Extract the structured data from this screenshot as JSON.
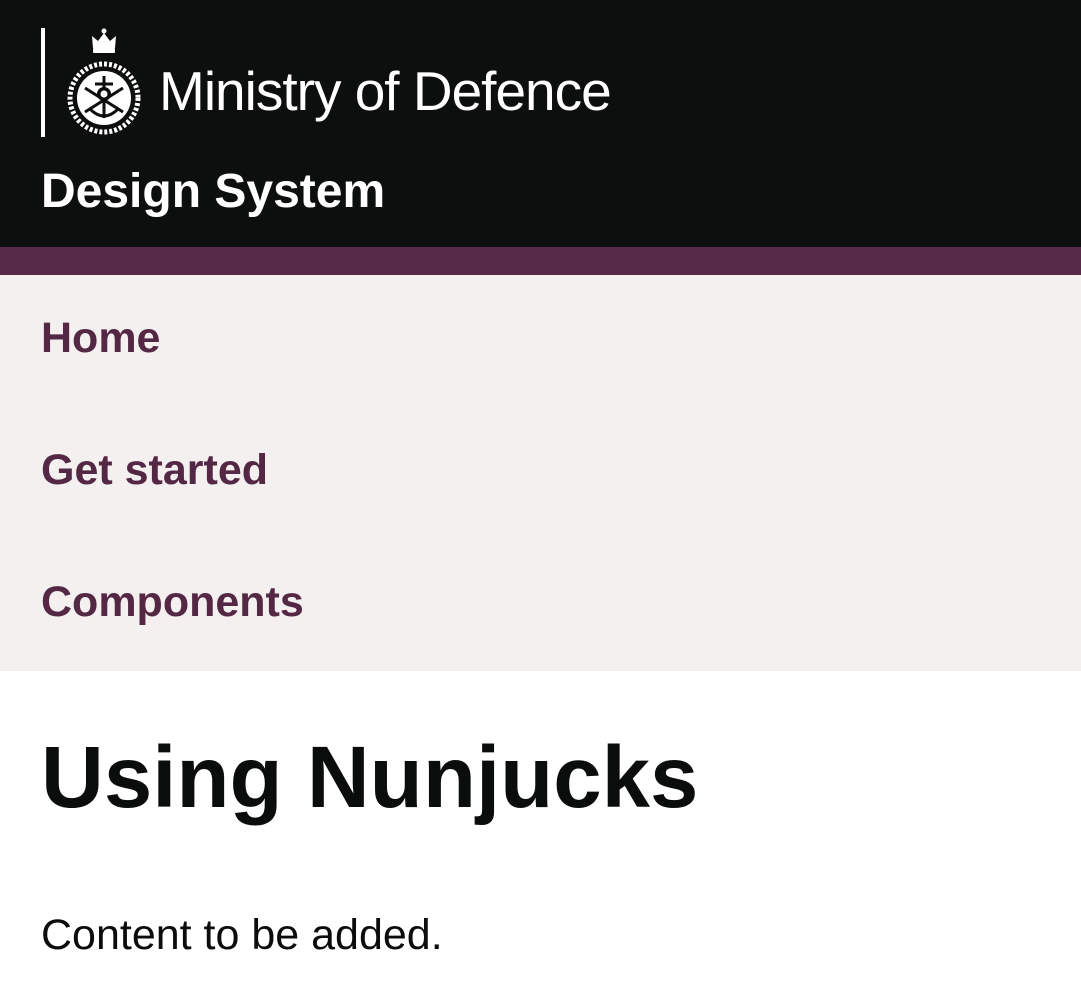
{
  "header": {
    "organisation": "Ministry of Defence",
    "service_name": "Design System",
    "crest_icon": "mod-crest-icon",
    "background": "#0d0e0e",
    "accent_color": "#572a47"
  },
  "nav": {
    "background": "#f3f0ef",
    "link_color": "#542744",
    "items": [
      {
        "label": "Home"
      },
      {
        "label": "Get started"
      },
      {
        "label": "Components"
      }
    ]
  },
  "main": {
    "title": "Using Nunjucks",
    "body": "Content to be added."
  }
}
